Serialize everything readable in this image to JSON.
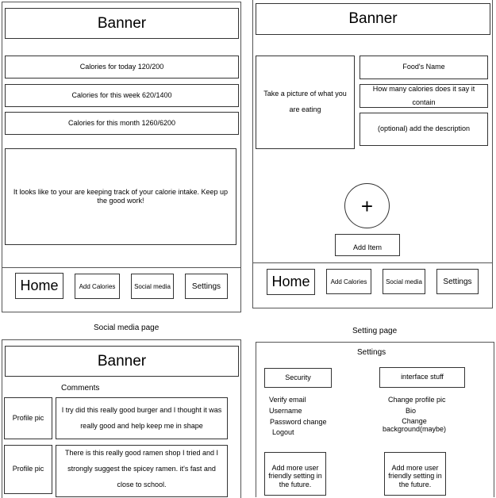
{
  "home_page": {
    "banner": "Banner",
    "stats": [
      "Calories for today 120/200",
      "Calories for this week 620/1400",
      "Calories for this month 1260/6200"
    ],
    "message": "It looks like to your are keeping track of your calorie intake. Keep up the good work!",
    "nav": {
      "home": "Home",
      "add": "Add Calories",
      "social": "Social media",
      "settings": "Settings"
    }
  },
  "add_page": {
    "banner": "Banner",
    "photo": "Take a picture of what you are eating",
    "food_name": "Food's Name",
    "calories_question": "How many calories does it say it contain",
    "description": "(optional) add the  description",
    "plus": "+",
    "add_item": "Add Item",
    "nav": {
      "home": "Home",
      "add": "Add Calories",
      "social": "Social media",
      "settings": "Settings"
    }
  },
  "social_page": {
    "caption": "Social media page",
    "banner": "Banner",
    "comments_label": "Comments",
    "posts": [
      {
        "pic": "Profile pic",
        "text": "I try did this really good burger  and I thought it was really good and help keep me in shape"
      },
      {
        "pic": "Profile pic",
        "text": "There is this really good ramen shop I tried and I strongly suggest the spicey ramen. it's fast and close to school."
      }
    ]
  },
  "settings_page": {
    "caption": "Setting page",
    "title": "Settings",
    "security": {
      "heading": "Security",
      "items": [
        "Verify email",
        "Username",
        "Password change",
        "Logout"
      ],
      "more": "Add more user friendly setting in the future."
    },
    "interface": {
      "heading": "interface stuff",
      "items": [
        "Change profile pic",
        "Bio",
        "Change background(maybe)"
      ],
      "more": "Add more user friendly setting in the future."
    }
  }
}
